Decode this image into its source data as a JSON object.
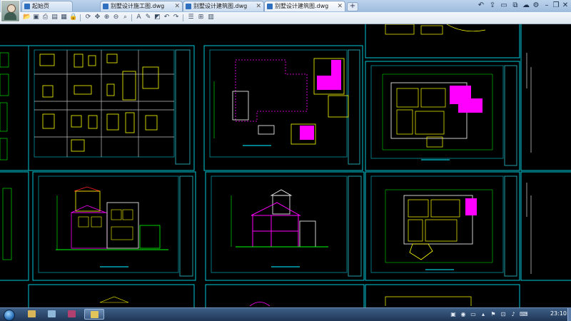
{
  "tabs": [
    {
      "label": "起始页",
      "active": false
    },
    {
      "label": "别墅设计施工图.dwg",
      "active": false
    },
    {
      "label": "别墅设计建筑图.dwg",
      "active": false
    },
    {
      "label": "别墅设计建筑图.dwg",
      "active": true
    }
  ],
  "new_tab_label": "+",
  "window_controls": {
    "minimize": "–",
    "restore": "❐",
    "close": "✕"
  },
  "taskbar": {
    "clock": "23:10"
  },
  "colors": {
    "frame": "#00c8d8",
    "wall_yellow": "#ffff00",
    "magenta_fill": "#ff00ff",
    "dim_green": "#00ff00",
    "red_line": "#ff2020",
    "taskbar": "#2c4a70"
  }
}
